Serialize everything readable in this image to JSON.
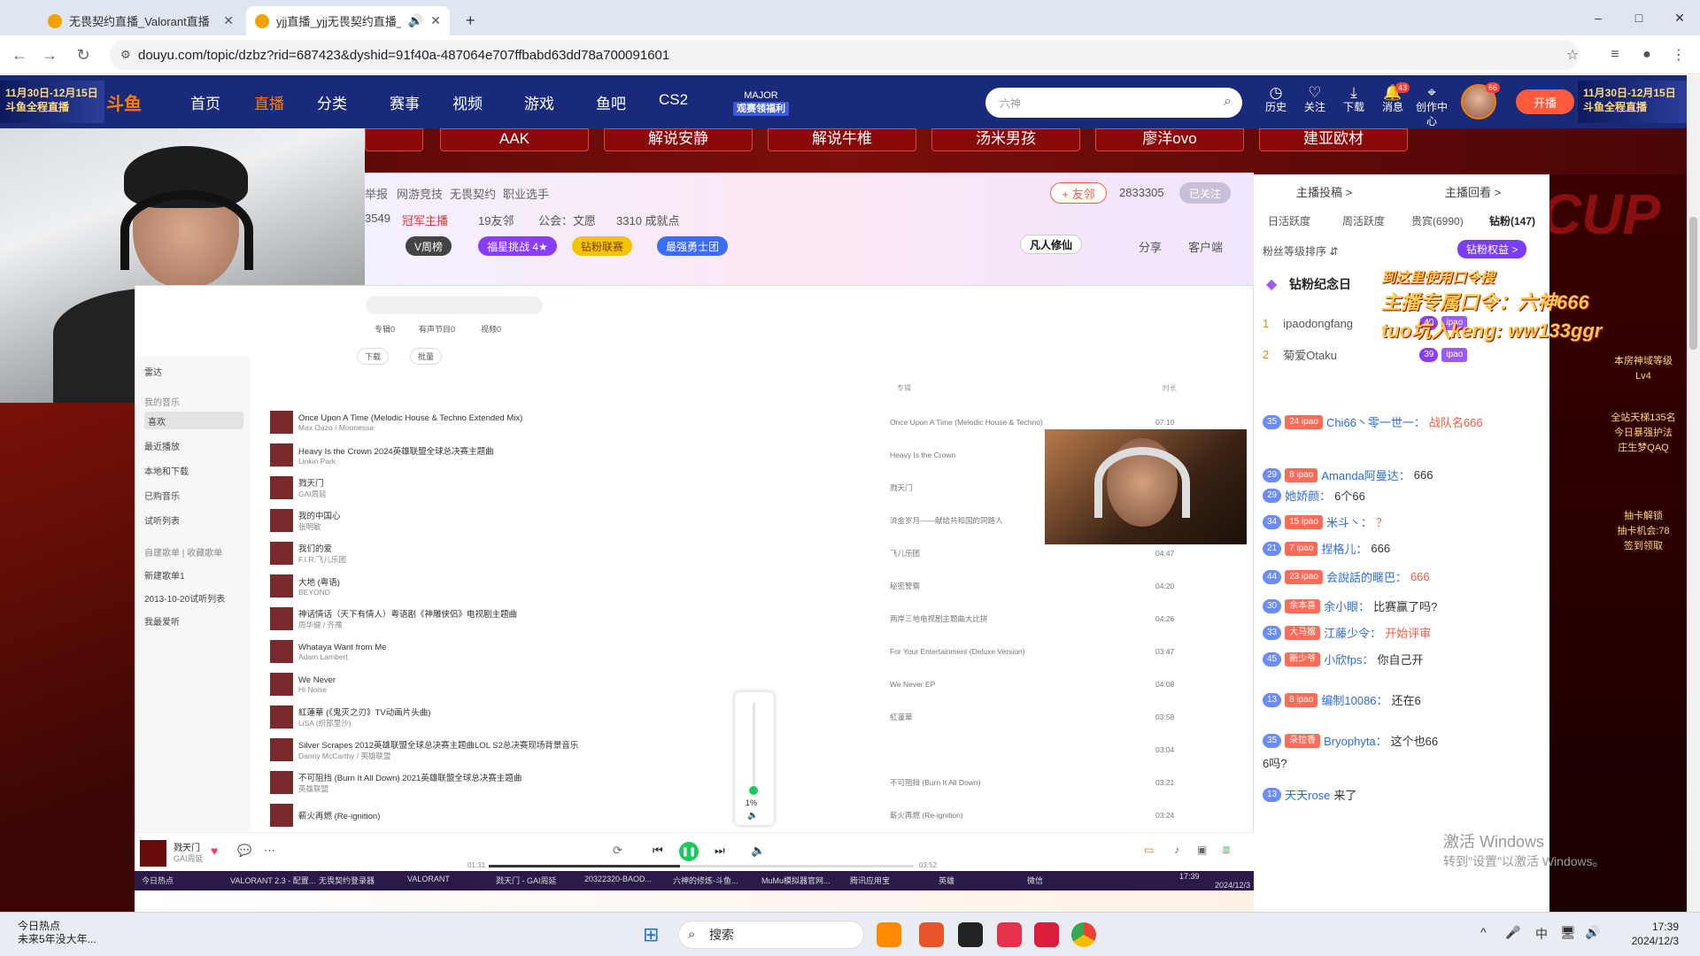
{
  "browser": {
    "tabs": [
      {
        "label": "无畏契约直播_Valorant直播",
        "active": false
      },
      {
        "label": "yjj直播_yjj无畏契约直播_yj",
        "active": true
      }
    ],
    "url": "douyu.com/topic/dzbz?rid=687423&dyshid=91f40a-487064e707ffbabd63dd78a700091601",
    "new_tab": "+",
    "win_controls": [
      "–",
      "□",
      "✕"
    ]
  },
  "douyu": {
    "banner_left": "11月30日-12月15日",
    "banner_left_sub": "斗鱼全程直播",
    "banner_right": "11月30日-12月15日",
    "banner_right_sub": "斗鱼全程直播",
    "logo": "斗鱼",
    "nav": [
      "首页",
      "直播",
      "分类",
      "赛事",
      "视频",
      "游戏",
      "鱼吧",
      "CS2"
    ],
    "major_label": "MAJOR",
    "major_sub": "观赛领福利",
    "search_placeholder": "六神",
    "icons": [
      {
        "label": "历史",
        "icon": "clock-icon"
      },
      {
        "label": "关注",
        "icon": "heart-icon"
      },
      {
        "label": "下载",
        "icon": "download-icon"
      },
      {
        "label": "消息",
        "icon": "bell-icon",
        "badge": "43"
      },
      {
        "label": "创作中心",
        "icon": "location-icon"
      }
    ],
    "avatar_badge": "66",
    "live_button": "开播"
  },
  "room_buttons": [
    "AAK",
    "解说安静",
    "解说牛椎",
    "汤米男孩",
    "廖洋ovo",
    "建亚欧材"
  ],
  "room_info": {
    "breadcrumb": [
      "举报",
      "网游竞技",
      "无畏契约",
      "职业选手"
    ],
    "follow_btn": "+ 友邻",
    "follow_count": "2833305",
    "followed": "已关注",
    "room_id": "3549",
    "champion": "冠军主播",
    "fans": "19友邻",
    "guild": "公会：文愿",
    "achievements": "3310 成就点",
    "pills": [
      "V周榜",
      "福星挑战 4★",
      "钻粉联赛",
      "最强勇士团"
    ],
    "share": "分享",
    "service": "客户端",
    "sponsor": "凡人修仙"
  },
  "music": {
    "tabs": [
      "专辑0",
      "有声节目0",
      "视频0"
    ],
    "actions": [
      "下载",
      "批量"
    ],
    "sidebar": [
      "雷达",
      "我的音乐",
      "喜欢",
      "最近播放",
      "本地和下载",
      "已购音乐",
      "试听列表",
      "自建歌单 | 收藏歌单",
      "新建歌单1",
      "2013-10-20试听列表",
      "我最爱听"
    ],
    "col_album": "专辑",
    "col_time": "时长",
    "songs": [
      {
        "title": "Once Upon A Time (Melodic House & Techno Extended Mix)",
        "artist": "Max Oazo / Moonessa",
        "album": "Once Upon A Time (Melodic House & Techno)",
        "dur": "07:10"
      },
      {
        "title": "Heavy Is the Crown 2024英雄联盟全球总决赛主题曲",
        "artist": "Linkin Park",
        "album": "Heavy Is the Crown",
        "dur": ""
      },
      {
        "title": "戮天门",
        "artist": "GAI周延",
        "album": "戮天门",
        "dur": ""
      },
      {
        "title": "我的中国心",
        "artist": "张明敏",
        "album": "流金岁月——献给共和国的同路人",
        "dur": ""
      },
      {
        "title": "我们的爱",
        "artist": "F.I.R.飞儿乐团",
        "album": "飞儿乐团",
        "dur": "04:47"
      },
      {
        "title": "大地 (粤语)",
        "artist": "BEYOND",
        "album": "秘密警察",
        "dur": "04:20"
      },
      {
        "title": "神话情话（天下有情人）粤语剧《神雕侠侣》电视剧主题曲",
        "artist": "周华健 / 齐豫",
        "album": "两岸三地电视剧主题曲大比拼",
        "dur": "04:26"
      },
      {
        "title": "Whataya Want from Me",
        "artist": "Adam Lambert",
        "album": "For Your Entertainment (Deluxe Version)",
        "dur": "03:47"
      },
      {
        "title": "We Never",
        "artist": "Hi Noise",
        "album": "We Never EP",
        "dur": "04:08"
      },
      {
        "title": "紅蓮華 (《鬼灭之刃》TV动画片头曲)",
        "artist": "LiSA (织部里沙)",
        "album": "紅蓮華",
        "dur": "03:58"
      },
      {
        "title": "Silver Scrapes 2012英雄联盟全球总决赛主题曲LOL S2总决赛现场背景音乐",
        "artist": "Danny McCarthy / 英雄联盟",
        "album": "",
        "dur": "03:04"
      },
      {
        "title": "不可阻挡 (Burn It All Down) 2021英雄联盟全球总决赛主题曲",
        "artist": "英雄联盟",
        "album": "不可阻挡 (Burn It All Down)",
        "dur": "03:21"
      },
      {
        "title": "薪火再燃 (Re-ignition)",
        "artist": "",
        "album": "薪火再燃 (Re-ignition)",
        "dur": "03:24"
      }
    ],
    "now_playing": "戮天门",
    "now_artist": "GAI周延",
    "time_left": "01:31",
    "time_right": "03:52",
    "volume_pct": 0.01,
    "volume_label": "1%"
  },
  "inner_taskbar": [
    "今日热点",
    "VALORANT 2.3 - 配置...",
    "无畏契约登录器",
    "VALORANT",
    "戮天门 - GAI周延",
    "20322320-BAOD...",
    "六神的修炼-斗鱼...",
    "MuMu模拟器官网...",
    "腾讯应用宝",
    "英雄",
    "微信",
    "17:39",
    "2024/12/3"
  ],
  "chat": {
    "top_links": [
      "主播投稿 >",
      "主播回看 >"
    ],
    "tabs": [
      "日活跃度",
      "周活跃度",
      "贵宾(6990)",
      "钻粉(147)"
    ],
    "fan_sort": "粉丝等级排序 ⇵",
    "fan_rights": "钻粉权益 >",
    "diamond_day": "钻粉纪念日",
    "ranks": [
      {
        "pos": "1",
        "name": "ipaodongfang",
        "lvl": "40",
        "fan": "ipao"
      },
      {
        "pos": "2",
        "name": "菊爱Otaku",
        "lvl": "39",
        "fan": "ipao"
      }
    ],
    "messages": [
      {
        "lvl": "35",
        "fan": "24 ipao",
        "nick": "Chi66丶零一世一：",
        "text": "战队名666",
        "orange": true
      },
      {
        "lvl": "29",
        "fan": "8 ipao",
        "nick": "Amanda阿曼达：",
        "text": "666",
        "orange": false
      },
      {
        "lvl": "29",
        "fan": "",
        "nick": "她娇颜：",
        "text": "6个66",
        "orange": false
      },
      {
        "lvl": "34",
        "fan": "15 ipao",
        "nick": "米斗丶：",
        "text": "？",
        "orange": true
      },
      {
        "lvl": "21",
        "fan": "7 ipao",
        "nick": "捏格儿：",
        "text": "666",
        "orange": false
      },
      {
        "lvl": "44",
        "fan": "23 ipao",
        "nick": "会說話的暱巴：",
        "text": "666",
        "orange": true
      },
      {
        "lvl": "30",
        "fan": "余本喜",
        "nick": "余小眼：",
        "text": "比赛赢了吗?",
        "orange": false
      },
      {
        "lvl": "33",
        "fan": "大马猴",
        "nick": "江藤少令：",
        "text": "开始评审",
        "orange": true
      },
      {
        "lvl": "45",
        "fan": "新少爷",
        "nick": "小欣fps：",
        "text": "你自己开",
        "orange": false
      },
      {
        "lvl": "13",
        "fan": "8 ipao",
        "nick": "编制10086：",
        "text": "还在6",
        "orange": false
      },
      {
        "lvl": "35",
        "fan": "朵拉香",
        "nick": "Bryophyta：",
        "text": "这个也66",
        "orange": false
      },
      {
        "lvl": "",
        "fan": "",
        "nick": "",
        "text": "6吗?",
        "orange": false
      },
      {
        "lvl": "13",
        "fan": "",
        "nick": "天天rose",
        "text": "来了",
        "orange": false
      }
    ],
    "overlay_line1": "到这里使用口令搜",
    "overlay_line2": "主播专属口令：六神666",
    "overlay_line3": "tuo坑入keng: ww133ggr",
    "side_ad": [
      "本房神域等级",
      "Lv4",
      "全站天梯135名",
      "今日暴强护法",
      "庄生梦QAQ",
      "抽卡解锁",
      "抽卡机会:78",
      "签到领取"
    ],
    "activate_line1": "激活 Windows",
    "activate_line2": "转到\"设置\"以激活 Windows。",
    "cup_text": "CUP"
  },
  "windows": {
    "weather_title": "今日热点",
    "weather_sub": "未来5年没大年...",
    "search": "搜索",
    "clock_time": "17:39",
    "clock_date": "2024/12/3",
    "tray": [
      "^",
      "🎤",
      "中",
      "🖥",
      "🔊"
    ]
  },
  "colors": {
    "accent": "#ff7a00",
    "douyu_nav": "#1a2a7a",
    "room_red": "#7a0f0b",
    "chat_nick": "#2b6de0",
    "play_green": "#1ec760"
  }
}
